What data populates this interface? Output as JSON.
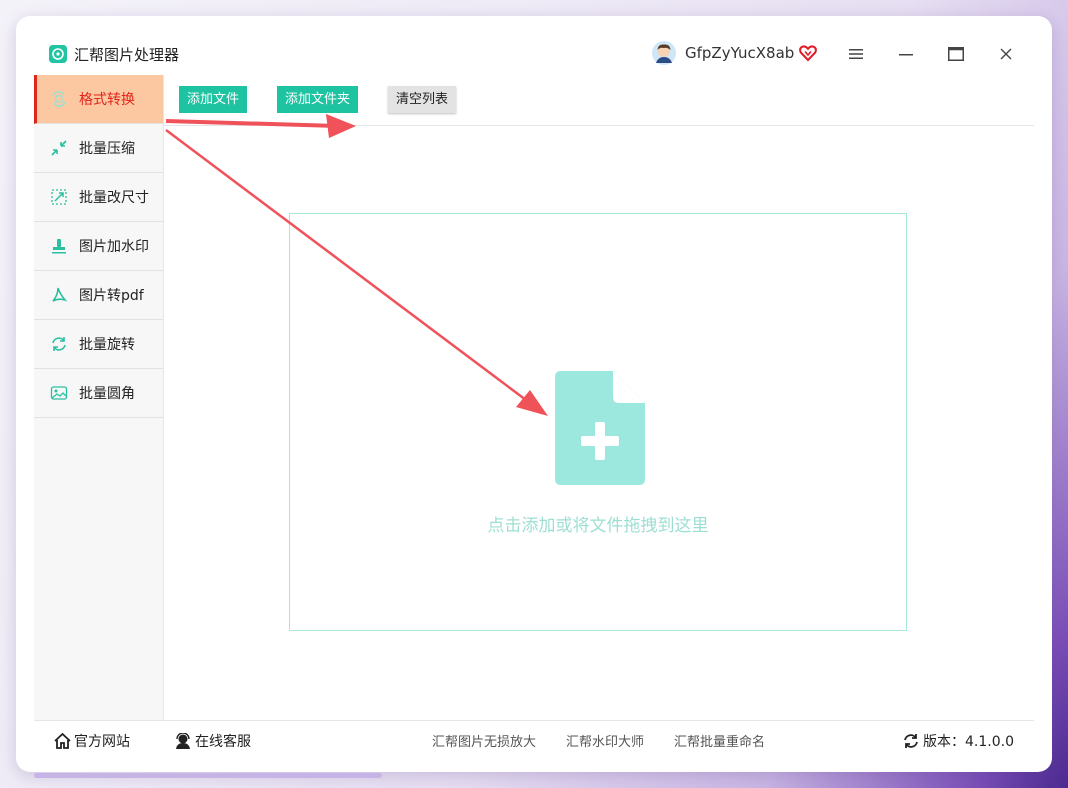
{
  "app": {
    "title": "汇帮图片处理器",
    "logo_icon": "app-logo-icon"
  },
  "user": {
    "name": "GfpZyYucX8ab",
    "avatar_icon": "avatar-icon",
    "badge_icon": "vip-heart-icon"
  },
  "window_controls": {
    "menu": "≡",
    "minimize": "–",
    "maximize": "□",
    "close": "×"
  },
  "sidebar": {
    "items": [
      {
        "label": "格式转换",
        "icon": "format-convert-icon",
        "active": true
      },
      {
        "label": "批量压缩",
        "icon": "compress-icon"
      },
      {
        "label": "批量改尺寸",
        "icon": "resize-icon"
      },
      {
        "label": "图片加水印",
        "icon": "watermark-icon"
      },
      {
        "label": "图片转pdf",
        "icon": "pdf-icon"
      },
      {
        "label": "批量旋转",
        "icon": "rotate-icon"
      },
      {
        "label": "批量圆角",
        "icon": "rounded-corner-icon"
      }
    ]
  },
  "toolbar": {
    "add_file": "添加文件",
    "add_folder": "添加文件夹",
    "clear_list": "清空列表"
  },
  "dropzone": {
    "hint": "点击添加或将文件拖拽到这里",
    "icon": "add-file-icon"
  },
  "footer": {
    "official_site": "官方网站",
    "online_service": "在线客服",
    "products": [
      "汇帮图片无损放大",
      "汇帮水印大师",
      "汇帮批量重命名"
    ],
    "version_label": "版本：4.1.0.0"
  },
  "colors": {
    "accent": "#1ec3a2",
    "active_bg": "#fcc8a1",
    "active_text": "#e1251b",
    "arrow": "#f0525a"
  }
}
